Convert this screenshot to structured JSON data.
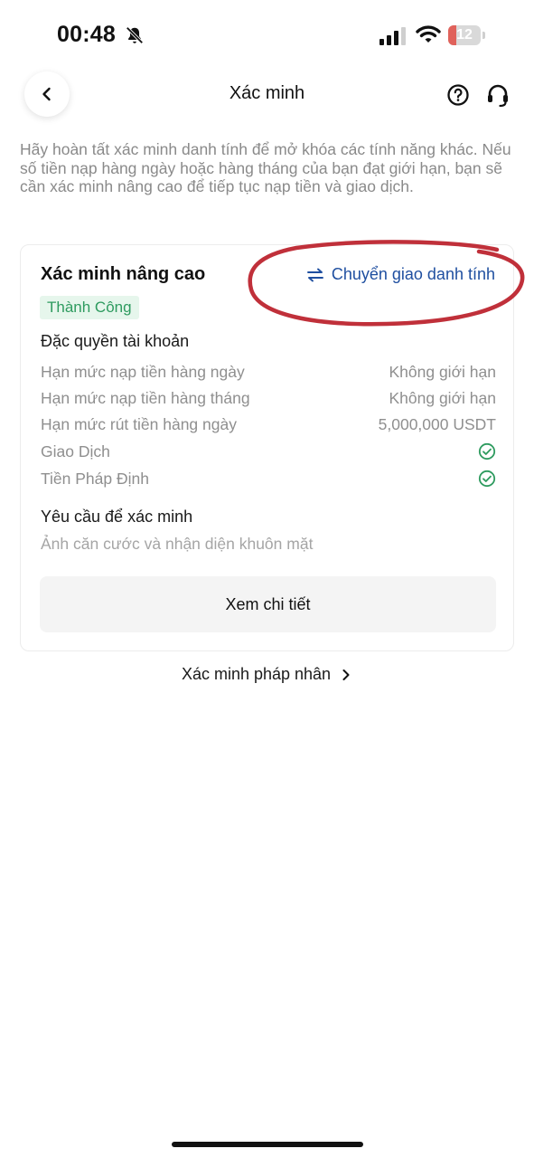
{
  "status_bar": {
    "time": "00:48",
    "battery": "12"
  },
  "header": {
    "title": "Xác minh"
  },
  "intro": "Hãy hoàn tất xác minh danh tính để mở khóa các tính năng khác. Nếu số tiền nạp hàng ngày hoặc hàng tháng của bạn đạt giới hạn, bạn sẽ cần xác minh nâng cao để tiếp tục nạp tiền và giao dịch.",
  "card": {
    "title": "Xác minh nâng cao",
    "transfer_label": "Chuyển giao danh tính",
    "status": "Thành Công",
    "privileges_heading": "Đặc quyền tài khoản",
    "privileges": [
      {
        "label": "Hạn mức nạp tiền hàng ngày",
        "value": "Không giới hạn"
      },
      {
        "label": "Hạn mức nạp tiền hàng tháng",
        "value": "Không giới hạn"
      },
      {
        "label": "Hạn mức rút tiền hàng ngày",
        "value": "5,000,000 USDT"
      },
      {
        "label": "Giao Dịch",
        "icon": "check-circle-icon"
      },
      {
        "label": "Tiền Pháp Định",
        "icon": "check-circle-icon"
      }
    ],
    "requirements_heading": "Yêu cầu để xác minh",
    "requirements_text": "Ảnh căn cước và nhận diện khuôn mặt",
    "details_button": "Xem chi tiết"
  },
  "legal_link": "Xác minh pháp nhân",
  "colors": {
    "accent_blue": "#1f4fa0",
    "success_green": "#2e9b5f",
    "annotation_red": "#c0303a"
  }
}
